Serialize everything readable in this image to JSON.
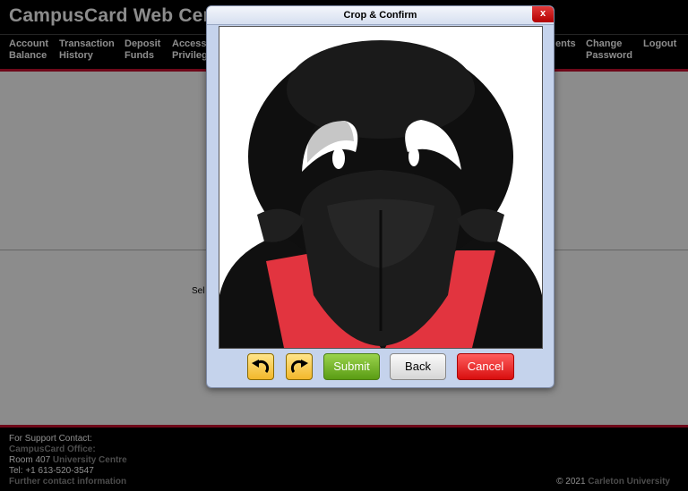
{
  "site": {
    "title": "CampusCard Web Center"
  },
  "nav": {
    "items": [
      {
        "label": "Account\nBalance"
      },
      {
        "label": "Transaction\nHistory"
      },
      {
        "label": "Deposit\nFunds"
      },
      {
        "label": "Access\nPrivileges"
      },
      {
        "label": "ents"
      },
      {
        "label": "Change\nPassword"
      },
      {
        "label": "Logout"
      }
    ]
  },
  "content": {
    "select_text": "Sel"
  },
  "dialog": {
    "title": "Crop & Confirm",
    "close_label": "x",
    "rotate_left_icon": "rotate-left-icon",
    "rotate_right_icon": "rotate-right-icon",
    "submit_label": "Submit",
    "back_label": "Back",
    "cancel_label": "Cancel"
  },
  "footer": {
    "support_label": "For Support Contact:",
    "office": "CampusCard Office:",
    "room_prefix": "Room 407 ",
    "room_link": "University Centre",
    "tel": "Tel: +1 613-520-3547",
    "more": "Further contact information",
    "copyright_prefix": "© 2021 ",
    "copyright_org": "Carleton University"
  },
  "colors": {
    "accent_red": "#c8102e",
    "dialog_bg": "#c5d3ec",
    "submit_green": "#6fb11f",
    "cancel_red": "#e81c1c"
  }
}
